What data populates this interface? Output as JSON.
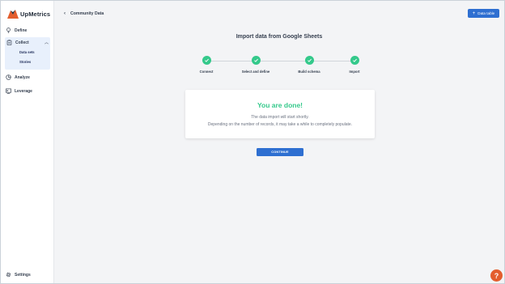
{
  "sidebar": {
    "brand": "UpMetrics",
    "define_label": "Define",
    "collect_label": "Collect",
    "collect_items": [
      "Data sets",
      "Stories"
    ],
    "analyze_label": "Analyze",
    "leverage_label": "Leverage",
    "settings_label": "Settings"
  },
  "header": {
    "breadcrumb": "Community Data",
    "primary_button": "Data table"
  },
  "main": {
    "title": "Import data from Google Sheets",
    "steps": [
      {
        "label": "Connect",
        "status": "complete"
      },
      {
        "label": "Select and define",
        "status": "complete"
      },
      {
        "label": "Build schema",
        "status": "complete"
      },
      {
        "label": "Import",
        "status": "complete"
      }
    ],
    "card": {
      "title": "You are done!",
      "line1": "The data import will start shortly.",
      "line2": "Depending on the number of records, it may take a while to completely populate."
    },
    "continue_button": "CONTINUE"
  },
  "help": {
    "label": "?"
  },
  "colors": {
    "accent": "#2e6fd1",
    "success": "#34c98b",
    "brand_orange": "#e35d2d",
    "active_nav_bg": "#e8f0fc"
  },
  "icons": {
    "brand": "upmetrics-logo-icon",
    "define": "lightbulb-icon",
    "collect": "clipboard-icon",
    "analyze": "chart-pie-icon",
    "leverage": "presentation-icon",
    "settings": "gear-icon",
    "back": "chevron-left-icon",
    "add": "plus-icon",
    "step_done": "check-icon"
  }
}
